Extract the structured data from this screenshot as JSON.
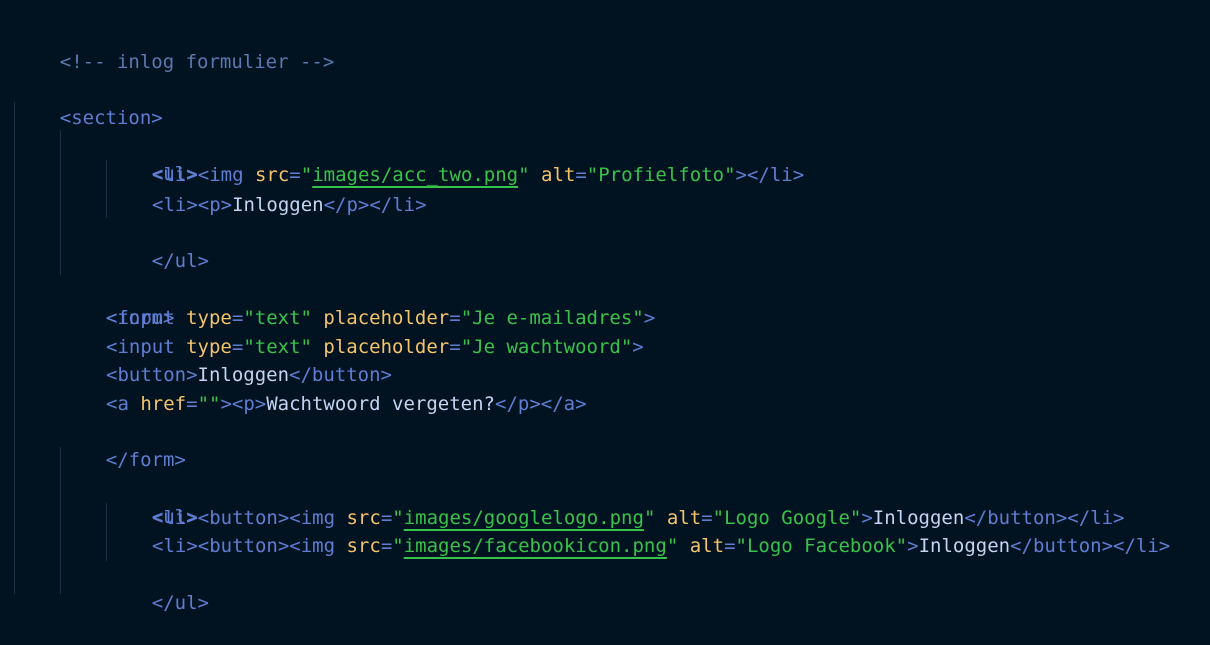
{
  "file": {
    "comment": "<!-- inlog formulier -->",
    "section_open": "<section>",
    "ul1": {
      "open": "<ul>",
      "item1": {
        "li_img": "<li><img",
        "src_attr": "src",
        "eq1": "=",
        "src_q1": "\"",
        "src_value": "images/acc_two.png",
        "src_q2": "\"",
        "alt_attr": "alt",
        "eq2": "=",
        "alt_value": "\"Profielfoto\"",
        "close": "></li>"
      },
      "item2": {
        "open": "<li><p>",
        "text": "Inloggen",
        "close": "</p></li>"
      },
      "close": "</ul>"
    },
    "form": {
      "open": "<form>",
      "input1": {
        "tag": "<input",
        "type_attr": "type",
        "eq1": "=",
        "type_value": "\"text\"",
        "placeholder_attr": "placeholder",
        "eq2": "=",
        "placeholder_value": "\"Je e-mailadres\"",
        "close": ">"
      },
      "input2": {
        "tag": "<input",
        "type_attr": "type",
        "eq1": "=",
        "type_value": "\"text\"",
        "placeholder_attr": "placeholder",
        "eq2": "=",
        "placeholder_value": "\"Je wachtwoord\"",
        "close": ">"
      },
      "button": {
        "open": "<button>",
        "text": "Inloggen",
        "close": "</button>"
      },
      "link": {
        "tag": "<a",
        "href_attr": "href",
        "eq": "=",
        "href_value": "\"\"",
        "mid": "><p>",
        "text": "Wachtwoord vergeten?",
        "close": "</p></a>"
      },
      "close": "</form>"
    },
    "ul2": {
      "open": "<ul>",
      "item1": {
        "open": "<li><button><img",
        "src_attr": "src",
        "eq1": "=",
        "src_q1": "\"",
        "src_value": "images/googlelogo.png",
        "src_q2": "\"",
        "alt_attr": "alt",
        "eq2": "=",
        "alt_value": "\"Logo Google\"",
        "gt": ">",
        "text": "Inloggen",
        "close": "</button></li>"
      },
      "item2": {
        "open": "<li><button><img",
        "src_attr": "src",
        "eq1": "=",
        "src_q1": "\"",
        "src_value": "images/facebookicon.png",
        "src_q2": "\"",
        "alt_attr": "alt",
        "eq2": "=",
        "alt_value": "\"Logo Facebook\"",
        "gt": ">",
        "text": "Inloggen",
        "close": "</button></li>"
      },
      "close": "</ul>"
    }
  },
  "colors": {
    "background": "#011221",
    "tag": "#5f7ed2",
    "attribute": "#f5c46a",
    "string": "#39c24b",
    "text": "#c4d4f2",
    "comment": "#5b78b1"
  }
}
